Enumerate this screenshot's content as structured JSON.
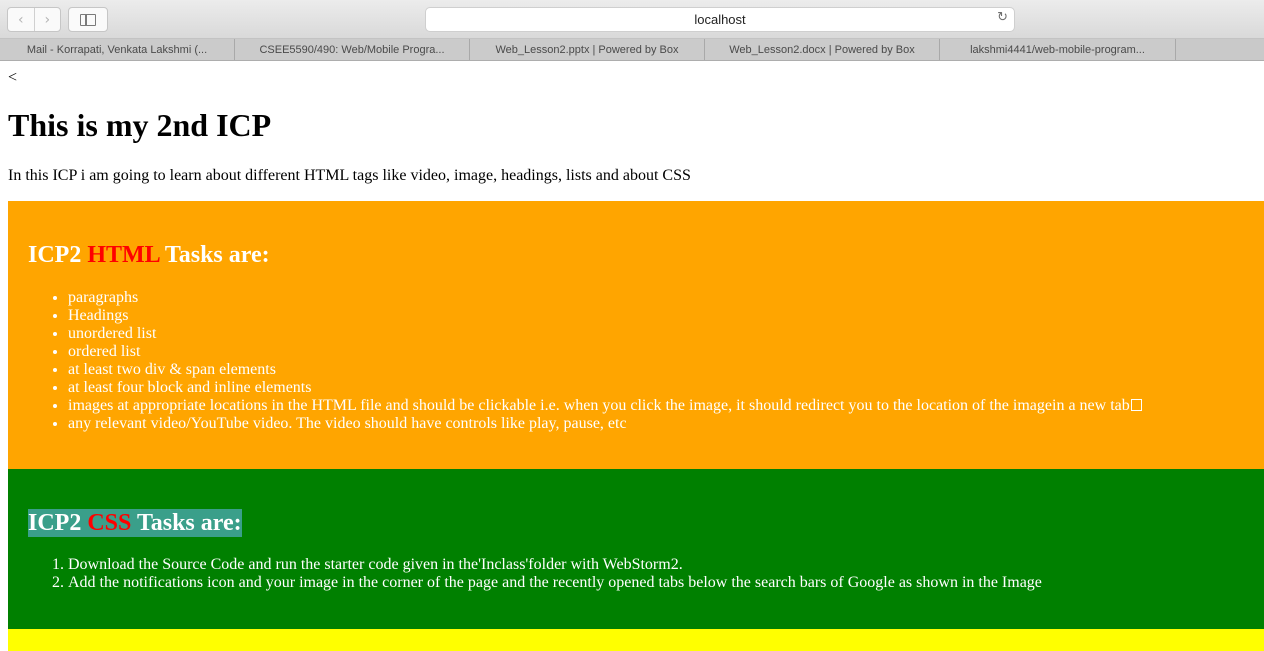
{
  "browser": {
    "address": "localhost",
    "tabs": [
      "Mail - Korrapati, Venkata Lakshmi (...",
      "CSEE5590/490: Web/Mobile Progra...",
      "Web_Lesson2.pptx | Powered by Box",
      "Web_Lesson2.docx | Powered by Box",
      "lakshmi4441/web-mobile-program..."
    ]
  },
  "page": {
    "stray_char": "<",
    "title": "This is my 2nd ICP",
    "intro": "In this ICP i am going to learn about different HTML tags like video, image, headings, lists and about CSS",
    "html_section": {
      "heading_prefix": "ICP2 ",
      "heading_highlight": "HTML",
      "heading_suffix": " Tasks are:",
      "items": [
        "paragraphs",
        "Headings",
        "unordered list",
        "ordered list",
        "at least two div & span elements",
        "at least four block and inline elements",
        "images at appropriate locations in the HTML file and should be clickable i.e. when you click the image, it should redirect you to the location of the imagein a new tab",
        "any relevant video/YouTube video. The video should have controls like play, pause, etc"
      ]
    },
    "css_section": {
      "heading_prefix": "ICP2 ",
      "heading_highlight": "CSS",
      "heading_suffix": " Tasks are:",
      "items": [
        "Download the Source Code and run the starter code given in the'Inclass'folder with WebStorm2.",
        "Add the notifications icon and your image in the corner of the page and the recently opened tabs below the search bars of Google as shown in the Image"
      ]
    }
  },
  "colors": {
    "orange_block": "#ffa500",
    "green_block": "#008000",
    "yellow_block": "#ffff00",
    "highlight_red": "#ff0000",
    "css_heading_bg": "#3a9f8a"
  }
}
